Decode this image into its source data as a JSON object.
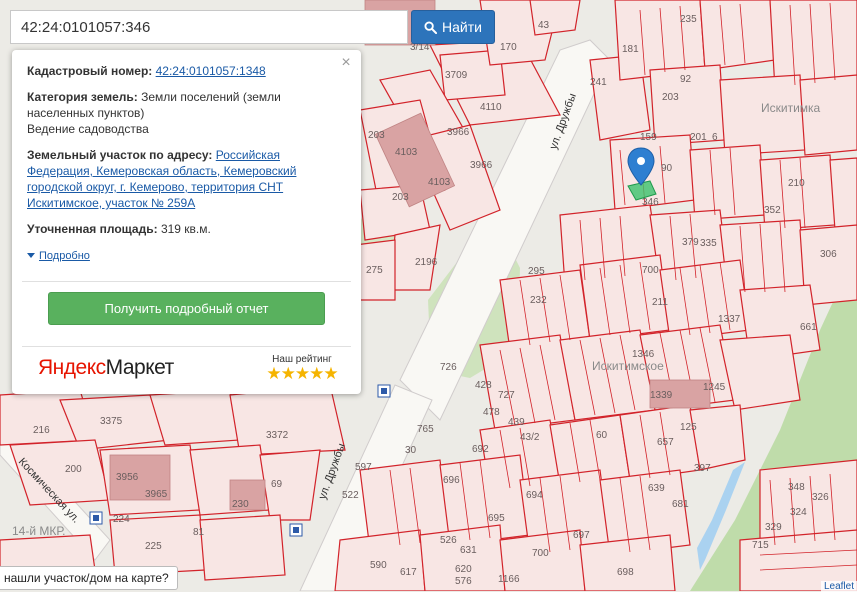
{
  "search": {
    "value": "42:24:0101057:346",
    "button_label": "Найти"
  },
  "popup": {
    "cadastral_label": "Кадастровый номер:",
    "cadastral_value": "42:24:0101057:1348",
    "category_label": "Категория земель:",
    "category_value": "Земли поселений (земли населенных пунктов)",
    "use_value": "Ведение садоводства",
    "address_label": "Земельный участок по адресу:",
    "address_value": "Российская Федерация, Кемеровская область, Кемеровский городской округ, г. Кемерово, территория СНТ Искитимское, участок № 259А",
    "area_label": "Уточненная площадь:",
    "area_value": "319 кв.м.",
    "more_label": "Подробно",
    "report_button": "Получить подробный отчет",
    "market_logo_ya": "Яндекс",
    "market_logo_rest": "Маркет",
    "rating_label": "Наш рейтинг",
    "rating_stars": "★★★★★",
    "close": "×"
  },
  "bottom_tip": "нашли участок/дом на карте?",
  "attribution": "Leaflet",
  "map_labels": {
    "parcels": [
      "43",
      "235",
      "170",
      "3/14",
      "3709",
      "4110",
      "3966",
      "3966",
      "203",
      "4103",
      "4103",
      "203",
      "2196",
      "275",
      "295",
      "232",
      "726",
      "428",
      "727",
      "478",
      "439",
      "43/2",
      "765",
      "692",
      "696",
      "694",
      "695",
      "697",
      "700",
      "698",
      "617",
      "597",
      "522",
      "526",
      "631",
      "620",
      "590",
      "576",
      "1166",
      "3375",
      "3372",
      "216",
      "200",
      "3956",
      "3965",
      "224",
      "225",
      "81",
      "230",
      "69",
      "30",
      "60",
      "90",
      "346",
      "379",
      "335",
      "700",
      "211",
      "1337",
      "1346",
      "1339",
      "1245",
      "657",
      "397",
      "639",
      "681",
      "125",
      "661",
      "348",
      "326",
      "324",
      "329",
      "715",
      "306",
      "210",
      "352",
      "241",
      "203",
      "92",
      "181",
      "159",
      "201",
      "6"
    ],
    "street_druzhby": "ул. Дружбы",
    "street_druzhby_2": "ул. Дружбы",
    "street_kosmicheskaya": "Космическая ул.",
    "district_14": "14-й МКР.",
    "district_iskitimskoe": "Искитимское",
    "area_iskitimka": "Искитимка"
  },
  "colors": {
    "parcel_stroke": "#d2232a",
    "parcel_fill": "#f7e4e2",
    "green": "#bfdcaa",
    "water": "#aad2f0",
    "building": "#d9a3a3",
    "search_button": "#2d74bb",
    "report_button": "#59b15e",
    "marker": "#2e7fd1"
  },
  "icons": {
    "search": "search-icon",
    "marker": "map-marker-icon",
    "bus_stop": "bus-stop-icon"
  }
}
